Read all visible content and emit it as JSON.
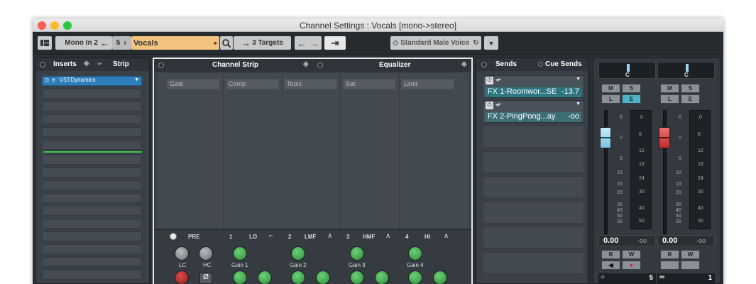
{
  "window": {
    "title": "Channel Settings : Vocals [mono->stereo]"
  },
  "toolbar": {
    "input": "Mono In 2",
    "channel_number": "5",
    "channel_name": "Vocals",
    "targets": "3 Targets",
    "preset": "Standard Male Voice"
  },
  "inserts": {
    "tab_inserts": "Inserts",
    "tab_strip": "Strip",
    "first_slot": "VSTDynamics"
  },
  "channel_strip": {
    "tab_channel_strip": "Channel Strip",
    "tab_equalizer": "Equalizer",
    "modules": [
      "Gate",
      "Comp",
      "Tools",
      "Sat",
      "Limit"
    ],
    "pre": "PRE",
    "bands": [
      {
        "num": "1",
        "name": "LO"
      },
      {
        "num": "2",
        "name": "LMF"
      },
      {
        "num": "3",
        "name": "HMF"
      },
      {
        "num": "4",
        "name": "HI"
      }
    ],
    "lc": "LC",
    "hc": "HC",
    "gains": [
      "Gain 1",
      "Gain 2",
      "Gain 3",
      "Gain 4"
    ]
  },
  "sends": {
    "tab_sends": "Sends",
    "tab_cue": "Cue Sends",
    "items": [
      {
        "name": "FX 1-Roomwor...SE",
        "value": "-13.7"
      },
      {
        "name": "FX 2-PingPong...ay",
        "value": "-oo"
      }
    ]
  },
  "mixer": {
    "pan_left": "C",
    "pan_right": "C",
    "m": "M",
    "s": "S",
    "l": "L",
    "e": "E",
    "r": "R",
    "w": "W",
    "scale_left": [
      "6",
      "0",
      "5",
      "10",
      "15",
      "20",
      "30",
      "40",
      "50",
      "00"
    ],
    "scale_right": [
      "0",
      "6",
      "12",
      "18",
      "24",
      "30",
      "40",
      "50"
    ],
    "vol1": "0.00",
    "peak1": "-oo",
    "vol2": "0.00",
    "peak2": "-oo",
    "num1": "5",
    "num2": "1",
    "colors": {
      "fader1": "#8fd0ea",
      "fader2": "#d7403f",
      "accent": "#4fb3c8"
    }
  }
}
